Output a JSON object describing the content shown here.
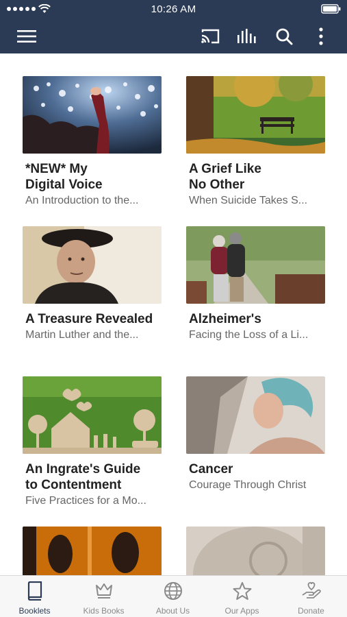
{
  "status_bar": {
    "time": "10:26 AM"
  },
  "toolbar": {
    "icons": [
      "menu-icon",
      "cast-icon",
      "audio-bars-icon",
      "search-icon",
      "more-vert-icon"
    ]
  },
  "booklets": [
    {
      "title": "*NEW* My\nDigital Voice",
      "subtitle": "An Introduction to the..."
    },
    {
      "title": "A Grief Like\nNo Other",
      "subtitle": "When Suicide Takes S..."
    },
    {
      "title": "A Treasure Revealed",
      "subtitle": "Martin Luther and the..."
    },
    {
      "title": "Alzheimer's",
      "subtitle": "Facing the Loss of a Li..."
    },
    {
      "title": "An Ingrate's Guide\nto Contentment",
      "subtitle": "Five Practices for a Mo..."
    },
    {
      "title": "Cancer",
      "subtitle": "Courage Through Christ"
    },
    {
      "title": "",
      "subtitle": ""
    },
    {
      "title": "",
      "subtitle": ""
    }
  ],
  "tabs": [
    {
      "label": "Booklets",
      "icon": "book-icon",
      "active": true
    },
    {
      "label": "Kids Books",
      "icon": "crown-icon",
      "active": false
    },
    {
      "label": "About Us",
      "icon": "globe-icon",
      "active": false
    },
    {
      "label": "Our Apps",
      "icon": "star-icon",
      "active": false
    },
    {
      "label": "Donate",
      "icon": "donate-hand-icon",
      "active": false
    }
  ],
  "colors": {
    "toolbar_bg": "#2c3b55",
    "tab_active": "#2c3b55",
    "tab_inactive": "#8a8a8a"
  }
}
